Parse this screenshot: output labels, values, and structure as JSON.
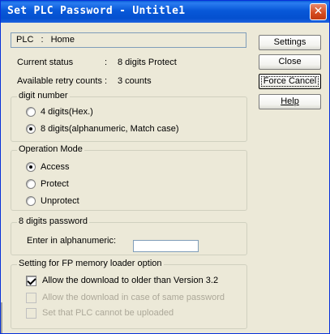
{
  "window": {
    "title": "Set PLC Password - Untitle1",
    "close_symbol": "✕"
  },
  "plc": {
    "label": "PLC",
    "separator": ":",
    "value": "Home"
  },
  "status": {
    "current_label": "Current status",
    "colon": ":",
    "current_value": "8 digits Protect",
    "retry_label": "Available retry counts",
    "retry_value": "3 counts"
  },
  "digit_group": {
    "title": "digit number",
    "options": [
      "4 digits(Hex.)",
      "8 digits(alphanumeric, Match case)"
    ],
    "selected": 1
  },
  "mode_group": {
    "title": "Operation Mode",
    "options": [
      "Access",
      "Protect",
      "Unprotect"
    ],
    "selected": 0
  },
  "password_group": {
    "title": "8 digits password",
    "field_label": "Enter in alphanumeric:",
    "field_value": ""
  },
  "loader_group": {
    "title": "Setting for FP memory loader option",
    "options": [
      {
        "label": "Allow the download to older than Version 3.2",
        "checked": true,
        "enabled": true
      },
      {
        "label": "Allow the download in case of same password",
        "checked": false,
        "enabled": false
      },
      {
        "label": "Set that PLC cannot be uploaded",
        "checked": false,
        "enabled": false
      }
    ]
  },
  "buttons": {
    "settings": "Settings",
    "close": "Close",
    "force_cancel": "Force Cancel",
    "help": "Help"
  }
}
